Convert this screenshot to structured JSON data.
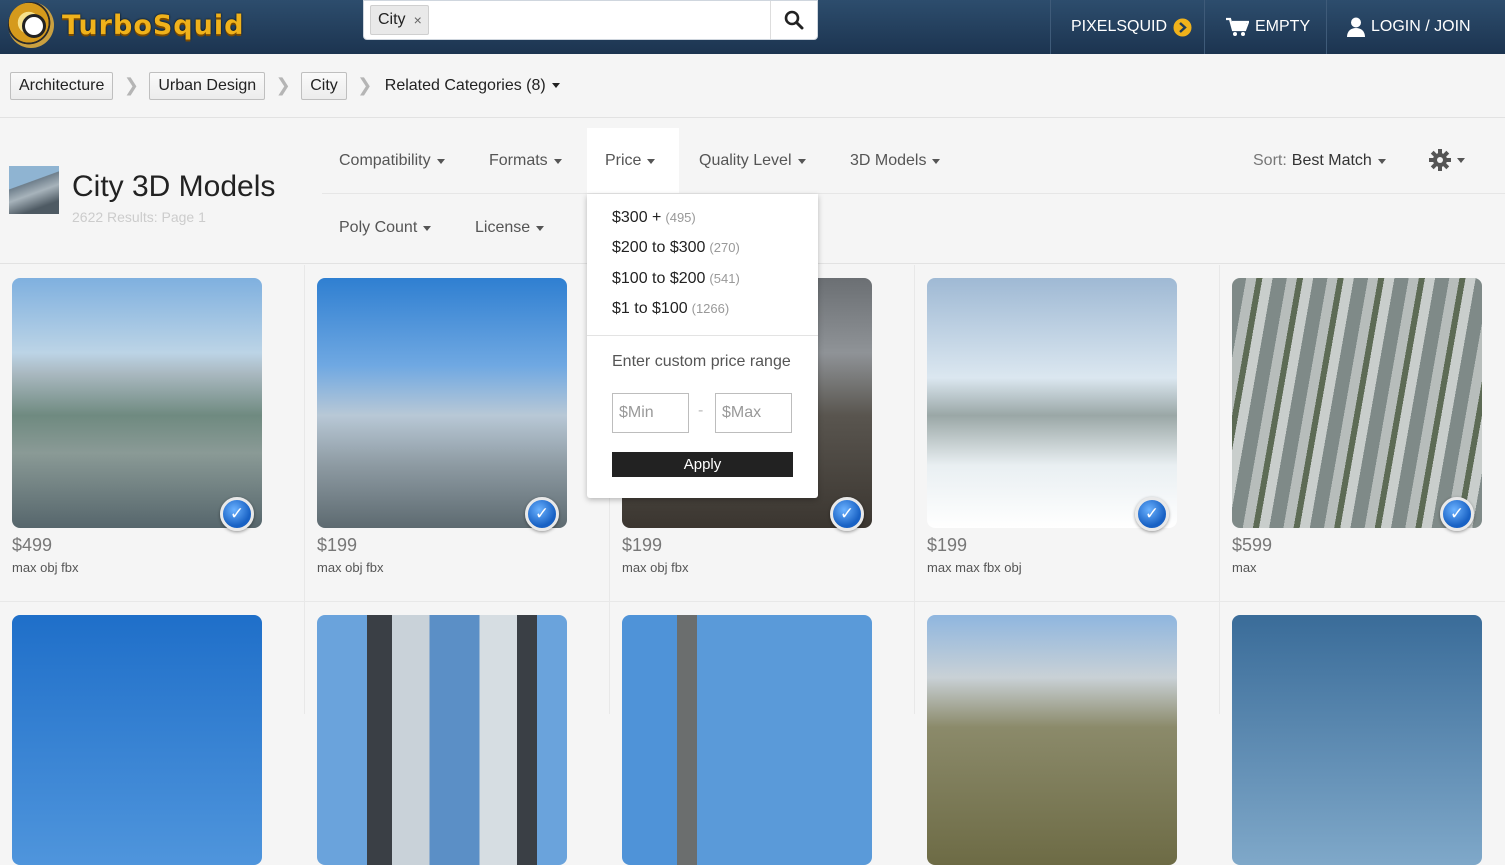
{
  "header": {
    "logo_text": "TurboSquid",
    "search": {
      "chip": "City",
      "chip_remove": "×",
      "placeholder": "",
      "value": ""
    },
    "nav": {
      "pixelsquid": "PIXELSQUID",
      "cart": "EMPTY",
      "login": "LOGIN / JOIN"
    }
  },
  "breadcrumbs": {
    "items": [
      "Architecture",
      "Urban Design",
      "City"
    ],
    "related": "Related Categories (8)"
  },
  "page": {
    "title": "City 3D Models",
    "results": "2622 Results: Page 1"
  },
  "filters": {
    "row1": [
      "Compatibility",
      "Formats",
      "Price",
      "Quality Level",
      "3D Models"
    ],
    "row2": [
      "Poly Count",
      "License"
    ],
    "sort_label": "Sort:",
    "sort_value": "Best Match"
  },
  "price_dropdown": {
    "options": [
      {
        "label": "$300 +",
        "count": "(495)"
      },
      {
        "label": "$200 to $300",
        "count": "(270)"
      },
      {
        "label": "$100 to $200",
        "count": "(541)"
      },
      {
        "label": "$1 to $100",
        "count": "(1266)"
      }
    ],
    "custom_label": "Enter custom price range",
    "min_placeholder": "$Min",
    "max_placeholder": "$Max",
    "dash": "-",
    "apply": "Apply"
  },
  "products": [
    {
      "price": "$499",
      "formats": "max obj fbx"
    },
    {
      "price": "$199",
      "formats": "max obj fbx"
    },
    {
      "price": "$199",
      "formats": "max obj fbx"
    },
    {
      "price": "$199",
      "formats": "max max fbx obj"
    },
    {
      "price": "$599",
      "formats": "max"
    }
  ],
  "colors": {
    "header_bg": "#1f3a57",
    "logo": "#f0b21b",
    "badge": "#1e6fd1"
  },
  "icons": {
    "search": "search-icon",
    "pixelsquid": "arrow-circle-icon",
    "cart": "cart-icon",
    "user": "user-icon",
    "settings": "gear-icon",
    "checkmark": "check-badge-icon"
  }
}
